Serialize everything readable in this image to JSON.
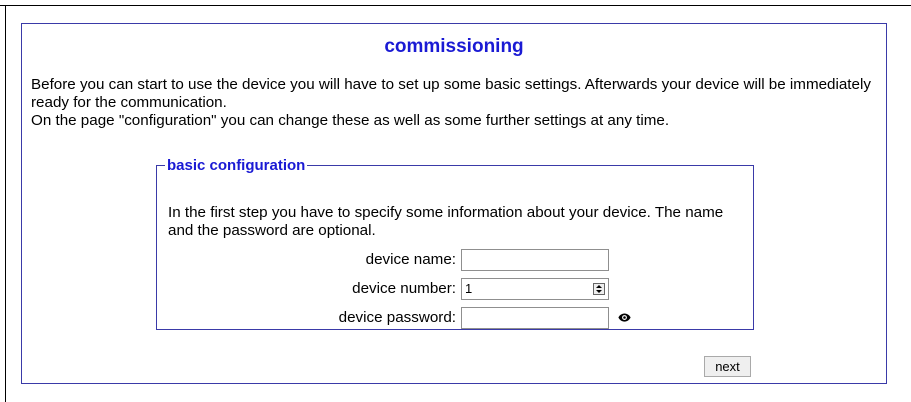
{
  "page": {
    "title": "commissioning",
    "intro_line1": "Before you can start to use the device you will have to set up some basic settings. Afterwards your device will be immediately ready for the communication.",
    "intro_line2": "On the page \"configuration\" you can change these as well as some further settings at any time."
  },
  "basic_configuration": {
    "legend": "basic configuration",
    "description": "In the first step you have to specify some information about your device. The name and the password are optional.",
    "fields": {
      "device_name": {
        "label": "device name:",
        "value": ""
      },
      "device_number": {
        "label": "device number:",
        "value": "1"
      },
      "device_password": {
        "label": "device password:",
        "value": ""
      }
    },
    "icons": {
      "password_toggle": "eye-icon"
    }
  },
  "actions": {
    "next_label": "next"
  }
}
